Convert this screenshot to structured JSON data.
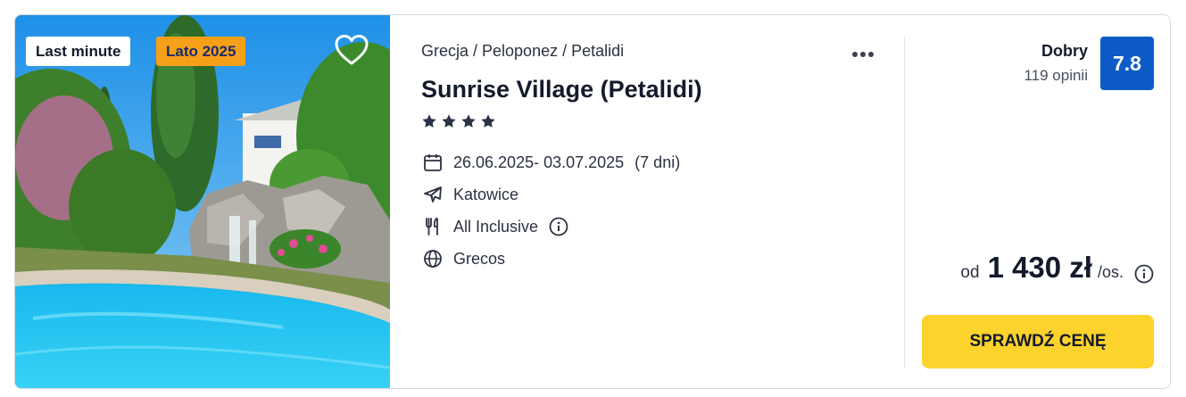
{
  "offer": {
    "badges": {
      "last_minute": "Last minute",
      "season": "Lato 2025"
    },
    "breadcrumb": "Grecja / Peloponez / Petalidi",
    "hotel_name": "Sunrise Village (Petalidi)",
    "stars": 4,
    "dates": "26.06.2025- 03.07.2025",
    "duration": "(7 dni)",
    "departure": "Katowice",
    "board": "All Inclusive",
    "operator": "Grecos",
    "rating": {
      "label": "Dobry",
      "reviews": "119 opinii",
      "score": "7.8"
    },
    "price": {
      "prefix": "od",
      "amount": "1 430 zł",
      "unit": "/os."
    },
    "cta_label": "SPRAWDŹ CENĘ"
  },
  "icons": {
    "heart": "heart-icon",
    "more": "more-dots-icon",
    "star": "star-icon",
    "calendar": "calendar-icon",
    "plane": "plane-icon",
    "board": "cutlery-icon",
    "globe": "globe-icon",
    "info": "info-icon"
  },
  "colors": {
    "score_bg": "#0d5bc6",
    "cta_bg": "#fcd22c",
    "season_badge": "#f6a01a"
  }
}
